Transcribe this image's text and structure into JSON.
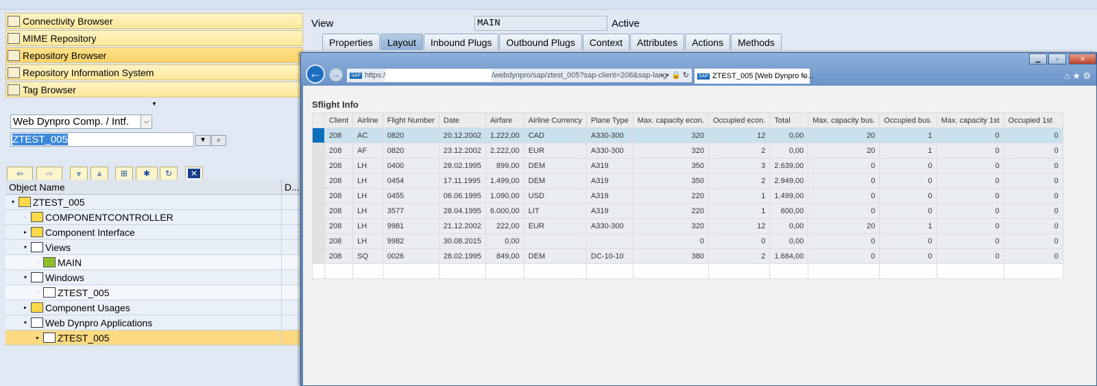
{
  "left_panel": {
    "accordion": [
      "Connectivity Browser",
      "MIME Repository",
      "Repository Browser",
      "Repository Information System",
      "Tag Browser"
    ],
    "object_type": "Web Dynpro Comp. / Intf.",
    "object_name": "ZTEST_005",
    "tree_header": {
      "name": "Object Name",
      "desc": "D..."
    },
    "tree": [
      {
        "label": "ZTEST_005",
        "level": 0,
        "exp": "▾",
        "icon": "component"
      },
      {
        "label": "COMPONENTCONTROLLER",
        "level": 1,
        "exp": "·",
        "icon": "controller"
      },
      {
        "label": "Component Interface",
        "level": 1,
        "exp": "▸",
        "icon": "component"
      },
      {
        "label": "Views",
        "level": 1,
        "exp": "▾",
        "icon": "window"
      },
      {
        "label": "MAIN",
        "level": 2,
        "exp": "·",
        "icon": "view"
      },
      {
        "label": "Windows",
        "level": 1,
        "exp": "▾",
        "icon": "window"
      },
      {
        "label": "ZTEST_005",
        "level": 2,
        "exp": "·",
        "icon": "window"
      },
      {
        "label": "Component Usages",
        "level": 1,
        "exp": "▸",
        "icon": "component"
      },
      {
        "label": "Web Dynpro Applications",
        "level": 1,
        "exp": "▾",
        "icon": "window"
      },
      {
        "label": "ZTEST_005",
        "level": 2,
        "exp": "▸",
        "icon": "application",
        "selected": true
      }
    ]
  },
  "editor": {
    "view_label": "View",
    "view_name": "MAIN",
    "status": "Active",
    "tabs": [
      "Properties",
      "Layout",
      "Inbound Plugs",
      "Outbound Plugs",
      "Context",
      "Attributes",
      "Actions",
      "Methods"
    ],
    "active_tab": "Layout"
  },
  "browser": {
    "url_prefix": "https:/",
    "url_suffix": "/webdynpro/sap/ztest_005?sap-client=208&sap-lang",
    "tab_title": "ZTEST_005 [Web Dynpro fo...",
    "sap_logo": "SAP"
  },
  "table": {
    "title": "Sflight Info",
    "columns": [
      "Client",
      "Airline",
      "Flight Number",
      "Date",
      "Airfare",
      "Airline Currency",
      "Plane Type",
      "Max. capacity econ.",
      "Occupied econ.",
      "Total",
      "Max. capacity bus.",
      "Occupied bus.",
      "Max. capacity 1st",
      "Occupied 1st"
    ],
    "rows": [
      [
        "208",
        "AC",
        "0820",
        "20.12.2002",
        "1.222,00",
        "CAD",
        "A330-300",
        "320",
        "12",
        "0,00",
        "20",
        "1",
        "0",
        "0"
      ],
      [
        "208",
        "AF",
        "0820",
        "23.12.2002",
        "2.222,00",
        "EUR",
        "A330-300",
        "320",
        "2",
        "0,00",
        "20",
        "1",
        "0",
        "0"
      ],
      [
        "208",
        "LH",
        "0400",
        "28.02.1995",
        "899,00",
        "DEM",
        "A319",
        "350",
        "3",
        "2.639,00",
        "0",
        "0",
        "0",
        "0"
      ],
      [
        "208",
        "LH",
        "0454",
        "17.11.1995",
        "1.499,00",
        "DEM",
        "A319",
        "350",
        "2",
        "2.949,00",
        "0",
        "0",
        "0",
        "0"
      ],
      [
        "208",
        "LH",
        "0455",
        "06.06.1995",
        "1.090,00",
        "USD",
        "A319",
        "220",
        "1",
        "1.499,00",
        "0",
        "0",
        "0",
        "0"
      ],
      [
        "208",
        "LH",
        "3577",
        "28.04.1995",
        "6.000,00",
        "LIT",
        "A319",
        "220",
        "1",
        "600,00",
        "0",
        "0",
        "0",
        "0"
      ],
      [
        "208",
        "LH",
        "9981",
        "21.12.2002",
        "222,00",
        "EUR",
        "A330-300",
        "320",
        "12",
        "0,00",
        "20",
        "1",
        "0",
        "0"
      ],
      [
        "208",
        "LH",
        "9982",
        "30.08.2015",
        "0,00",
        "",
        "",
        "0",
        "0",
        "0,00",
        "0",
        "0",
        "0",
        "0"
      ],
      [
        "208",
        "SQ",
        "0026",
        "28.02.1995",
        "849,00",
        "DEM",
        "DC-10-10",
        "380",
        "2",
        "1.684,00",
        "0",
        "0",
        "0",
        "0"
      ]
    ],
    "selected_row": 0
  }
}
